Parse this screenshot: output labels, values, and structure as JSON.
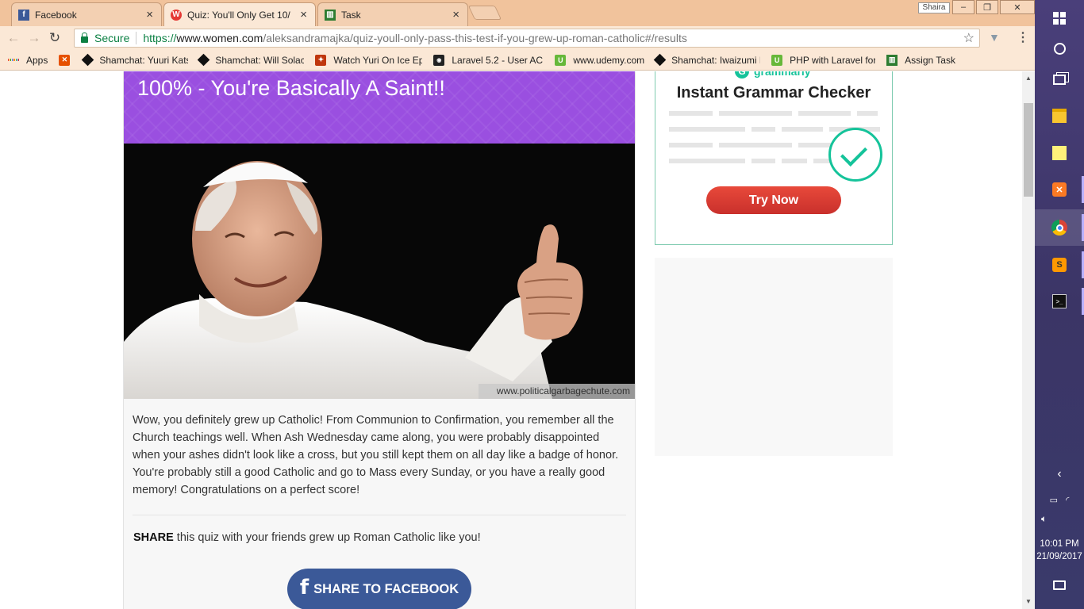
{
  "browser": {
    "tabs": [
      {
        "title": "Facebook",
        "favicon": "facebook-icon",
        "color": "#3b5998",
        "active": false
      },
      {
        "title": "Quiz: You'll Only Get 10/",
        "favicon": "women-com-icon",
        "color": "#e53935",
        "active": true
      },
      {
        "title": "Task",
        "favicon": "task-icon",
        "color": "#2e7d32",
        "active": false
      }
    ],
    "profile_name": "Shaira",
    "window_controls": {
      "minimize": "–",
      "maximize": "❐",
      "close": "✕"
    },
    "security_label": "Secure",
    "url": {
      "scheme": "https://",
      "host": "www.women.com",
      "path": "/aleksandramajka/quiz-youll-only-pass-this-test-if-you-grew-up-roman-catholic#/results"
    },
    "bookmarks": [
      {
        "label": "Apps",
        "icon": "apps-grid-icon"
      },
      {
        "label": "Shamchat: Yuuri Kats",
        "icon": "shamchat-icon",
        "color": "#1a1a1a"
      },
      {
        "label": "Shamchat: Will Solac",
        "icon": "shamchat-icon",
        "color": "#1a1a1a"
      },
      {
        "label": "Watch Yuri On Ice Ep",
        "icon": "flame-icon",
        "color": "#e65100"
      },
      {
        "label": "Laravel 5.2 - User AC",
        "icon": "laravel-icon",
        "color": "#222222"
      },
      {
        "label": "www.udemy.com",
        "icon": "udemy-icon",
        "color": "#67b83a"
      },
      {
        "label": "Shamchat: Iwaizumi H",
        "icon": "shamchat-icon",
        "color": "#1a1a1a"
      },
      {
        "label": "PHP with Laravel for",
        "icon": "udemy-icon",
        "color": "#67b83a"
      },
      {
        "label": "Assign Task",
        "icon": "task-icon",
        "color": "#2e7d32"
      }
    ]
  },
  "quiz": {
    "result_title": "100% - You're Basically A Saint!!",
    "header_color": "#9a4fe0",
    "photo_credit": "www.politicalgarbagechute.com",
    "result_text": "Wow, you definitely grew up Catholic! From Communion to Confirmation, you remember all the Church teachings well. When Ash Wednesday came along, you were probably disappointed when your ashes didn't look like a cross, but you still kept them on all day like a badge of honor. You're probably still a good Catholic and go to Mass every Sunday, or you have a really good memory! Congratulations on a perfect score!",
    "share_bold": "SHARE",
    "share_text": " this quiz with your friends grew up Roman Catholic like you!",
    "share_button_label": "SHARE TO FACEBOOK",
    "facebook_color": "#3b5998"
  },
  "ad": {
    "brand": "grammarly",
    "title": "Instant Grammar Checker",
    "cta": "Try Now",
    "accent": "#15c39a"
  },
  "taskbar": {
    "apps": [
      "windows-start-icon",
      "cortana-icon",
      "task-view-icon",
      "file-explorer-icon",
      "sticky-notes-icon",
      "xampp-icon",
      "chrome-icon",
      "sublime-text-icon",
      "command-prompt-icon"
    ],
    "time": "10:01 PM",
    "date": "21/09/2017"
  }
}
